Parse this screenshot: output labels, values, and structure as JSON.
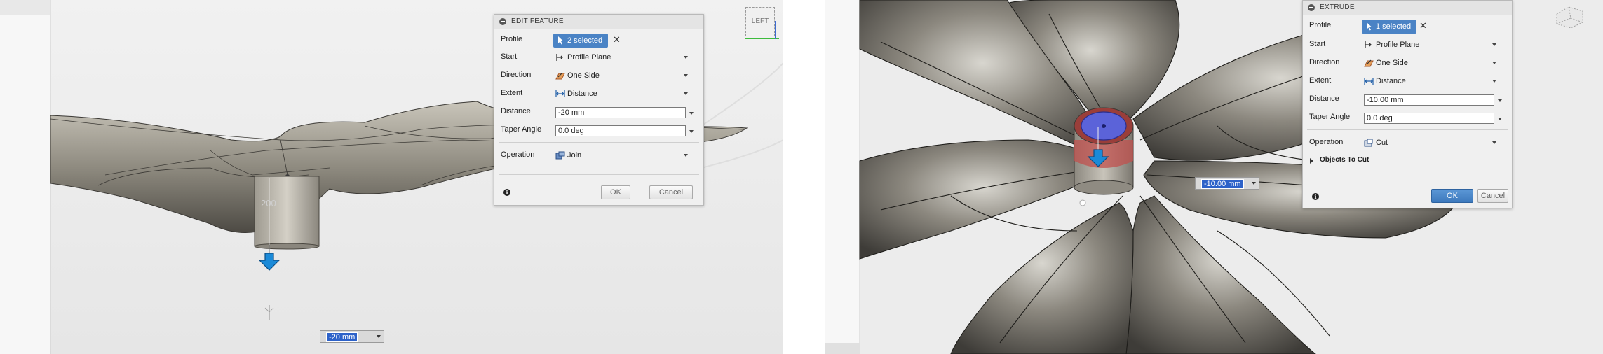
{
  "left": {
    "dialog": {
      "title": "EDIT FEATURE",
      "rows": {
        "profile": {
          "label": "Profile",
          "selection": "2 selected"
        },
        "start": {
          "label": "Start",
          "value": "Profile Plane"
        },
        "direction": {
          "label": "Direction",
          "value": "One Side"
        },
        "extent": {
          "label": "Extent",
          "value": "Distance"
        },
        "distance": {
          "label": "Distance",
          "value": "-20 mm"
        },
        "taper": {
          "label": "Taper Angle",
          "value": "0.0 deg"
        },
        "operation": {
          "label": "Operation",
          "value": "Join"
        }
      },
      "ok_label": "OK",
      "cancel_label": "Cancel"
    },
    "viewcube_label": "LEFT",
    "dimension_value": "-20 mm",
    "ghost_dimension": "200"
  },
  "right": {
    "dialog": {
      "title": "EXTRUDE",
      "rows": {
        "profile": {
          "label": "Profile",
          "selection": "1 selected"
        },
        "start": {
          "label": "Start",
          "value": "Profile Plane"
        },
        "direction": {
          "label": "Direction",
          "value": "One Side"
        },
        "extent": {
          "label": "Extent",
          "value": "Distance"
        },
        "distance": {
          "label": "Distance",
          "value": "-10.00 mm"
        },
        "taper": {
          "label": "Taper Angle",
          "value": "0.0 deg"
        },
        "operation": {
          "label": "Operation",
          "value": "Cut"
        }
      },
      "objects_to_cut_label": "Objects To Cut",
      "ok_label": "OK",
      "cancel_label": "Cancel"
    },
    "dimension_value": "-10.00 mm"
  },
  "colors": {
    "viewport_bg": "#ebebeb",
    "model_gray": "#6e6a62",
    "selection_blue": "#4a83c5",
    "accent_blue": "#2d62c9",
    "cut_red": "#c0504d"
  }
}
